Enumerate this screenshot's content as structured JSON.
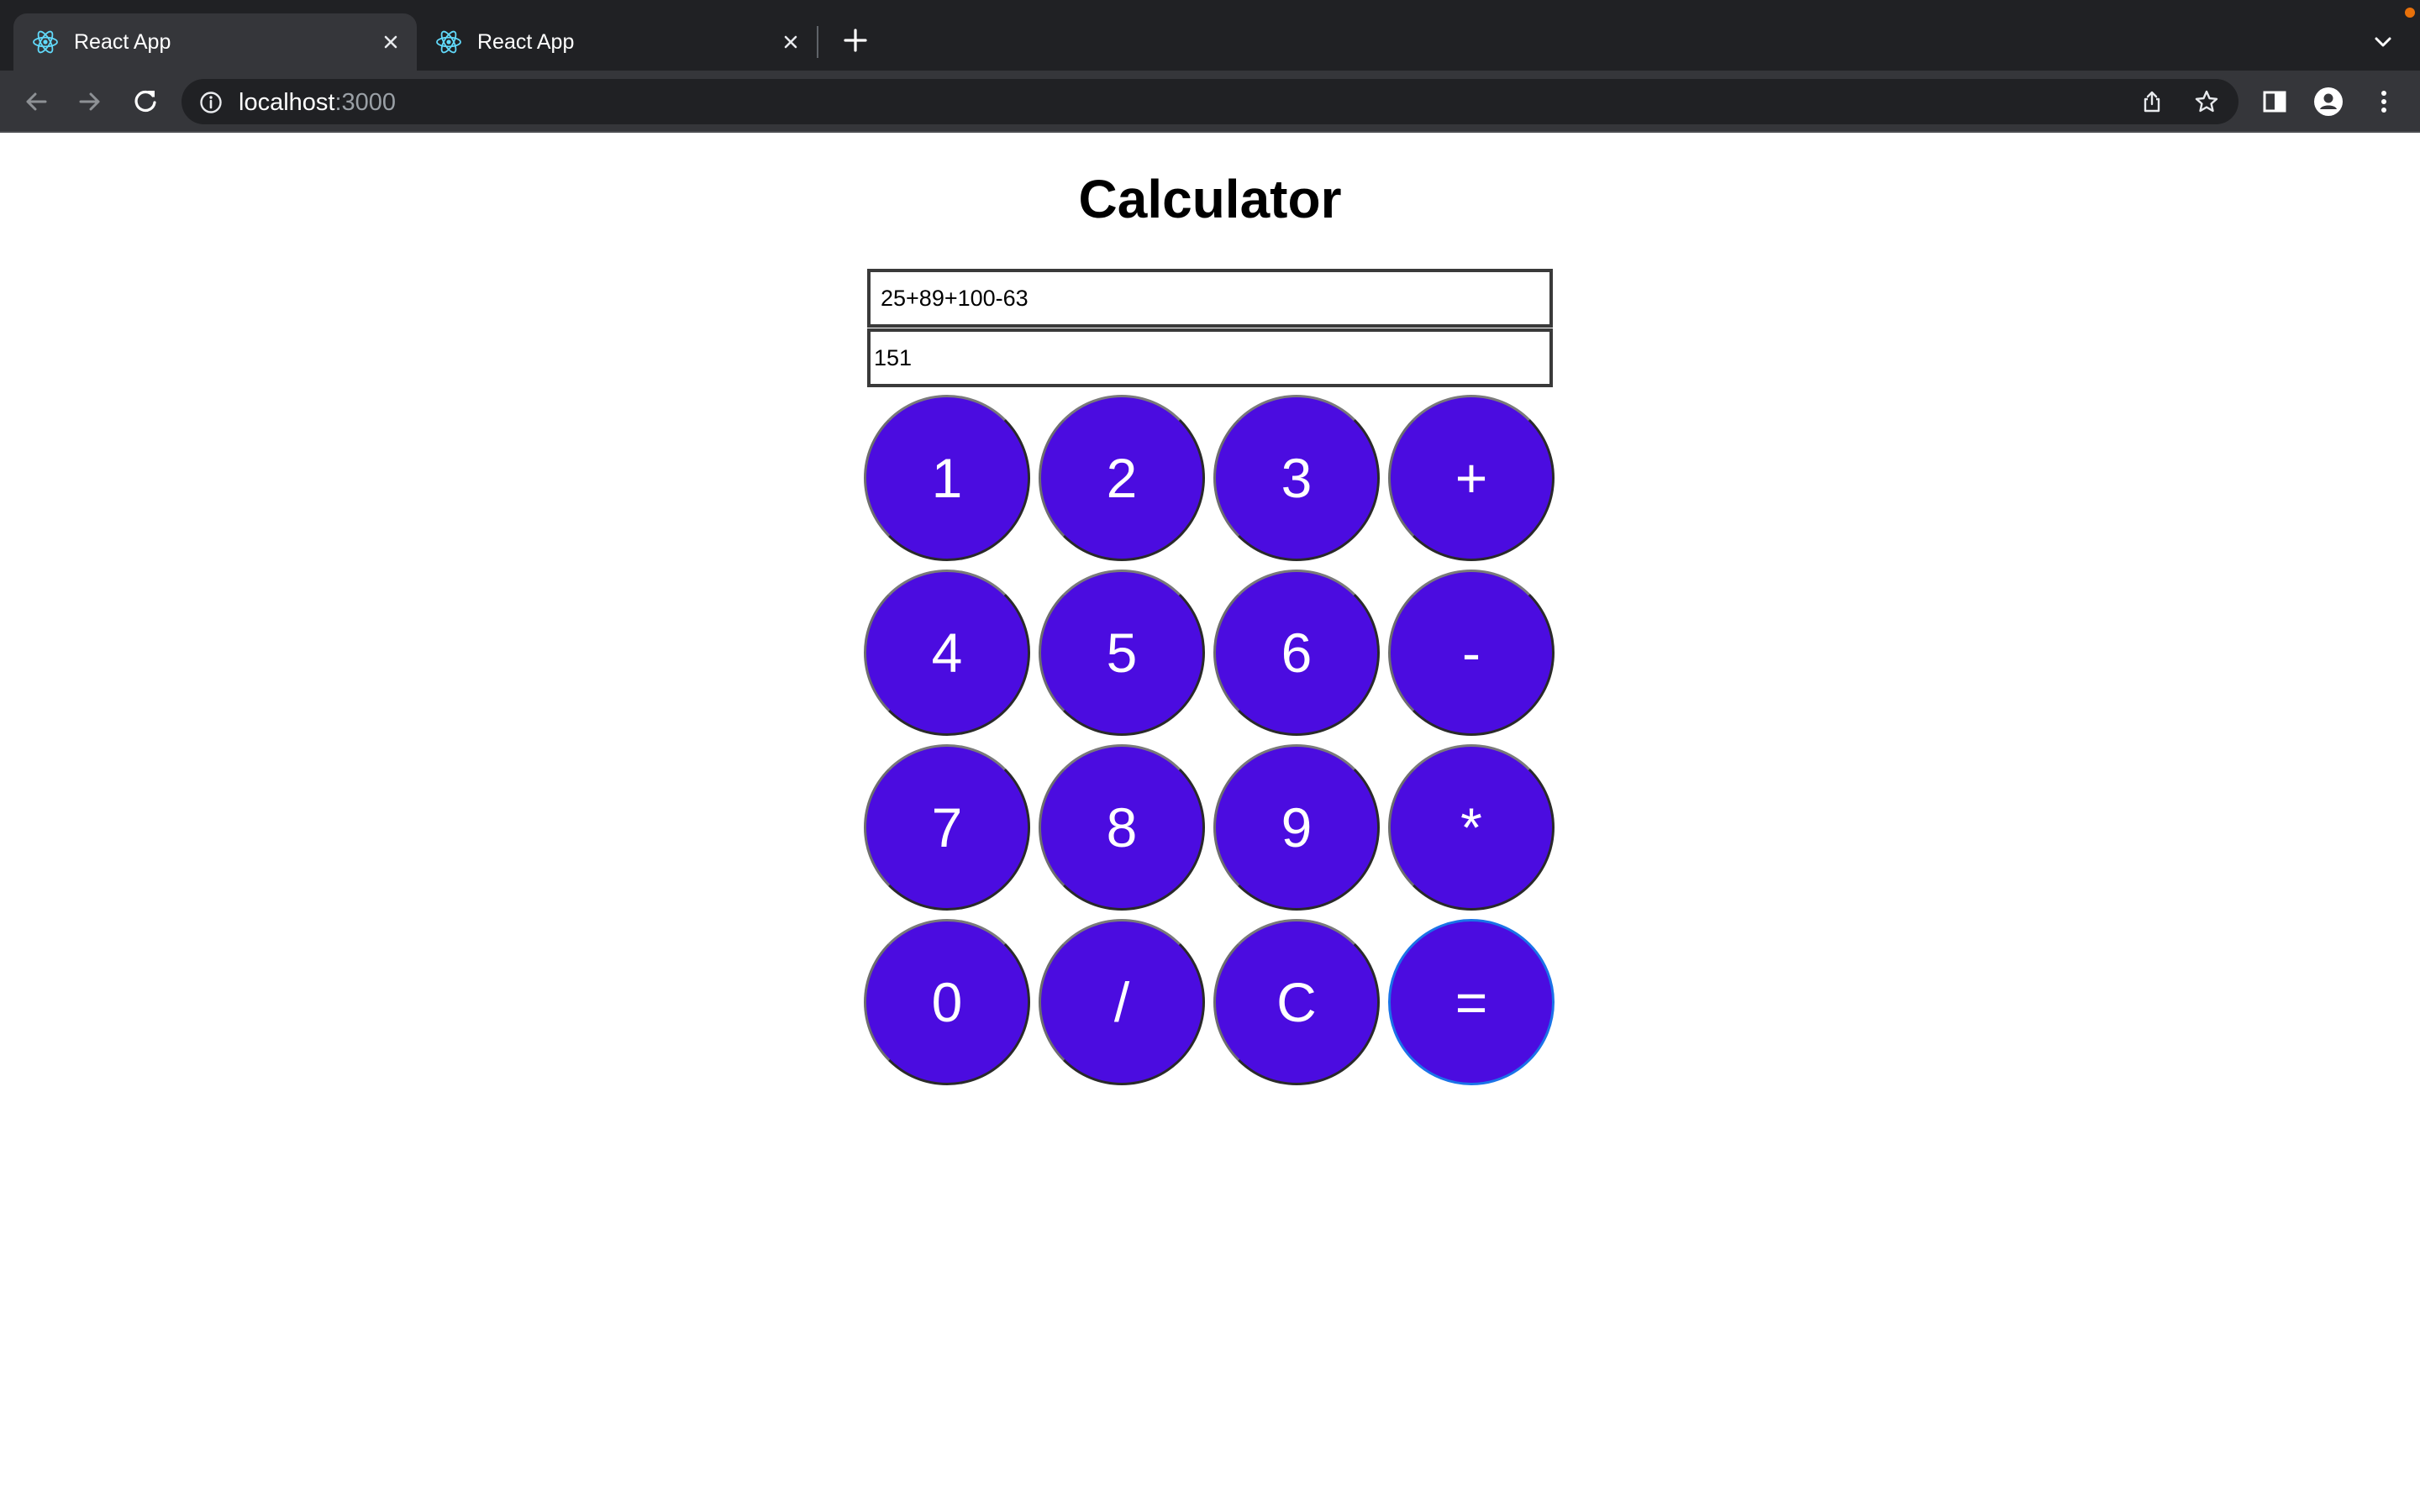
{
  "browser": {
    "tabs": [
      {
        "title": "React App",
        "active": true
      },
      {
        "title": "React App",
        "active": false
      }
    ],
    "address": {
      "host": "localhost",
      "port": ":3000"
    },
    "colors": {
      "tabstrip": "#202124",
      "toolbar": "#35363a",
      "omnibox": "#202124",
      "update_dot": "#e8710a"
    }
  },
  "page": {
    "title": "Calculator",
    "expression": "25+89+100-63",
    "result": "151",
    "keys": [
      "1",
      "2",
      "3",
      "+",
      "4",
      "5",
      "6",
      "-",
      "7",
      "8",
      "9",
      "*",
      "0",
      "/",
      "C",
      "="
    ],
    "colors": {
      "key_fill": "#4b0ce0",
      "key_text": "#ffffff",
      "focus_ring": "#1a73e8"
    }
  },
  "icons": {
    "favicon": "react-logo-icon",
    "tab_close": "close-icon",
    "new_tab": "plus-icon",
    "tab_search": "chevron-down-icon",
    "back": "arrow-left-icon",
    "forward": "arrow-right-icon",
    "reload": "reload-icon",
    "site_info": "info-icon",
    "share": "share-icon",
    "bookmark": "star-icon",
    "side_panel": "side-panel-icon",
    "profile": "profile-icon",
    "menu": "kebab-menu-icon"
  }
}
